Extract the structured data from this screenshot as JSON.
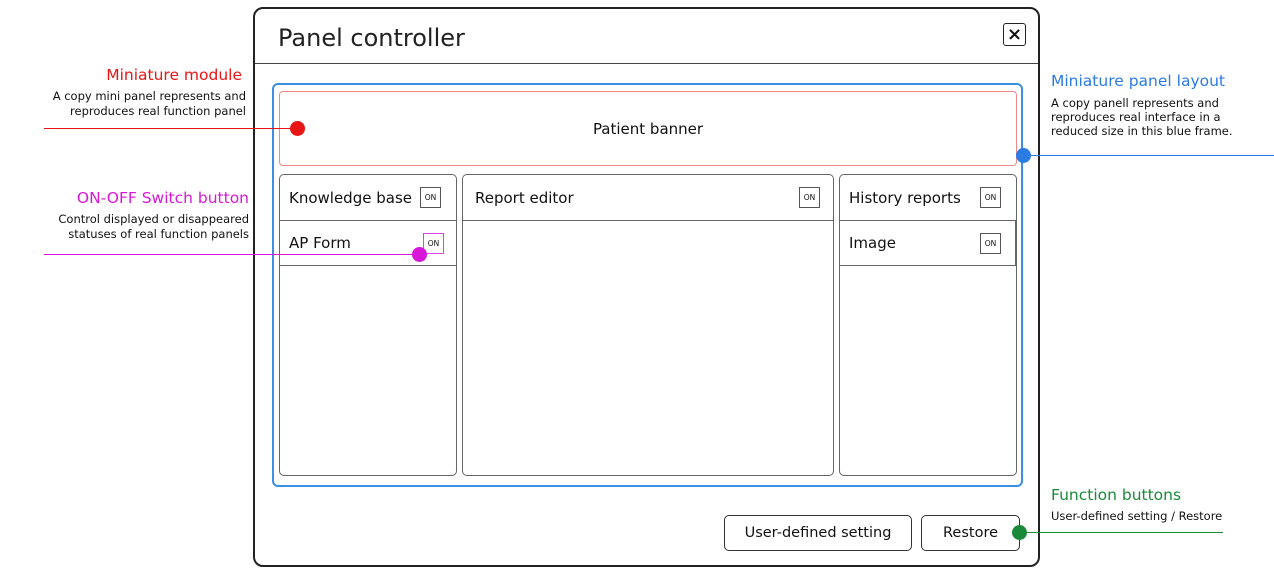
{
  "colors": {
    "red": "#e81515",
    "magenta": "#d818d8",
    "blue": "#2a7be4",
    "green": "#1a8a3a"
  },
  "dialog": {
    "title": "Panel controller",
    "close_icon": "close-icon",
    "close_glyph": "×"
  },
  "layout": {
    "patient_banner": "Patient banner",
    "left_column": [
      {
        "label": "Knowledge base",
        "toggle": "ON"
      },
      {
        "label": "AP Form",
        "toggle": "ON"
      }
    ],
    "middle_column": [
      {
        "label": "Report editor",
        "toggle": "ON"
      }
    ],
    "right_column": [
      {
        "label": "History reports",
        "toggle": "ON"
      },
      {
        "label": "Image",
        "toggle": "ON"
      }
    ]
  },
  "buttons": {
    "user_defined": "User-defined setting",
    "restore": "Restore"
  },
  "annotations": {
    "miniature_module": {
      "title": "Miniature module",
      "desc_line1": "A copy mini panel represents and",
      "desc_line2": "reproduces real function panel"
    },
    "switch_button": {
      "title": "ON-OFF Switch button",
      "desc_line1": "Control displayed or disappeared",
      "desc_line2": "statuses of real  function panels"
    },
    "miniature_layout": {
      "title": "Miniature panel layout",
      "desc_line1": "A copy panell represents and",
      "desc_line2": "reproduces real interface in a",
      "desc_line3": "reduced size in this blue frame."
    },
    "function_buttons": {
      "title": "Function buttons",
      "desc_line1": "User-defined setting / Restore"
    }
  }
}
